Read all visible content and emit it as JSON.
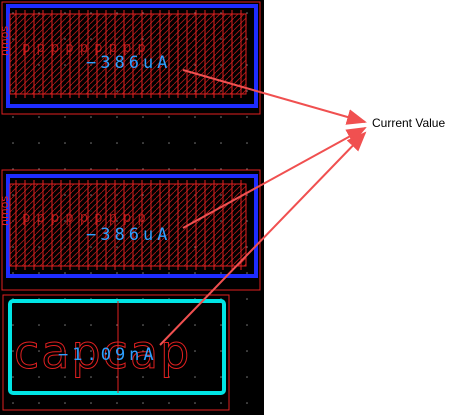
{
  "layout_view": {
    "blocks": [
      {
        "current": "−386uA",
        "pin_text": "nmos",
        "device_label": "ppppppppp"
      },
      {
        "current": "−386uA",
        "pin_text": "nmos",
        "device_label": "ppppppppp"
      }
    ],
    "cap_block": {
      "current": "−1.09nA",
      "label": "capcap"
    }
  },
  "annotation": {
    "label": "Current Value"
  },
  "colors": {
    "background": "#000000",
    "metal_red": "#e02020",
    "blue_ring": "#1e2cff",
    "current_text": "#2ea0ff",
    "cyan_ring": "#00e5e5",
    "arrow": "#f05050"
  }
}
